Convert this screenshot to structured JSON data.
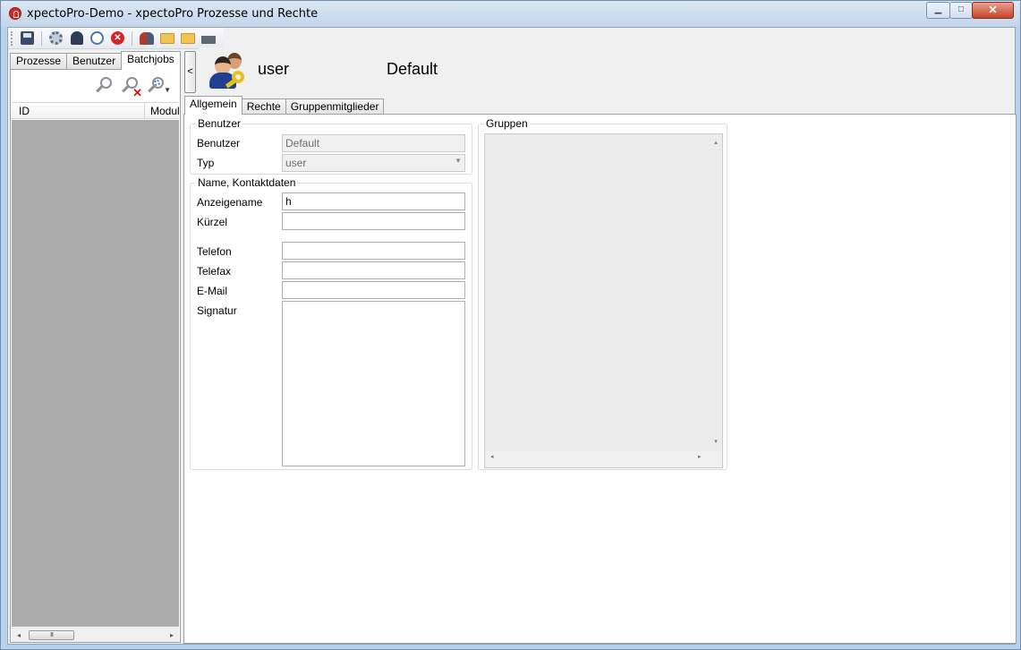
{
  "window": {
    "title": "xpectoPro-Demo - xpectoPro Prozesse und Rechte",
    "min_glyph": "▁",
    "max_glyph": "□",
    "close_glyph": "✕"
  },
  "toolbar": {
    "icons": [
      "save-icon",
      "settings-icon",
      "user-icon",
      "clock-icon",
      "stop-icon",
      "users-icon",
      "folder-open-icon",
      "folder-icon",
      "print-icon"
    ],
    "stop_glyph": "✕"
  },
  "left_tabs": [
    {
      "label": "Prozesse"
    },
    {
      "label": "Benutzer"
    },
    {
      "label": "Batchjobs"
    }
  ],
  "left_grid": {
    "columns": [
      "ID",
      "Modul"
    ],
    "scroll_left": "◂",
    "scroll_right": "▸",
    "thumb_grip": "III"
  },
  "collapse_button": "<",
  "header": {
    "type": "user",
    "name": "Default"
  },
  "main_tabs": [
    {
      "label": "Allgemein"
    },
    {
      "label": "Rechte"
    },
    {
      "label": "Gruppenmitglieder"
    }
  ],
  "benutzer_group": {
    "title": "Benutzer",
    "benutzer_label": "Benutzer",
    "benutzer_value": "Default",
    "typ_label": "Typ",
    "typ_value": "user",
    "typ_arrow": "▼"
  },
  "kontakt_group": {
    "title": "Name, Kontaktdaten",
    "anzeigename_label": "Anzeigename",
    "anzeigename_value": "h",
    "kuerzel_label": "Kürzel",
    "kuerzel_value": "",
    "telefon_label": "Telefon",
    "telefon_value": "",
    "telefax_label": "Telefax",
    "telefax_value": "",
    "email_label": "E-Mail",
    "email_value": "",
    "signatur_label": "Signatur",
    "signatur_value": ""
  },
  "gruppen_group": {
    "title": "Gruppen",
    "up": "▴",
    "down": "▾",
    "left": "◂",
    "right": "▸"
  }
}
